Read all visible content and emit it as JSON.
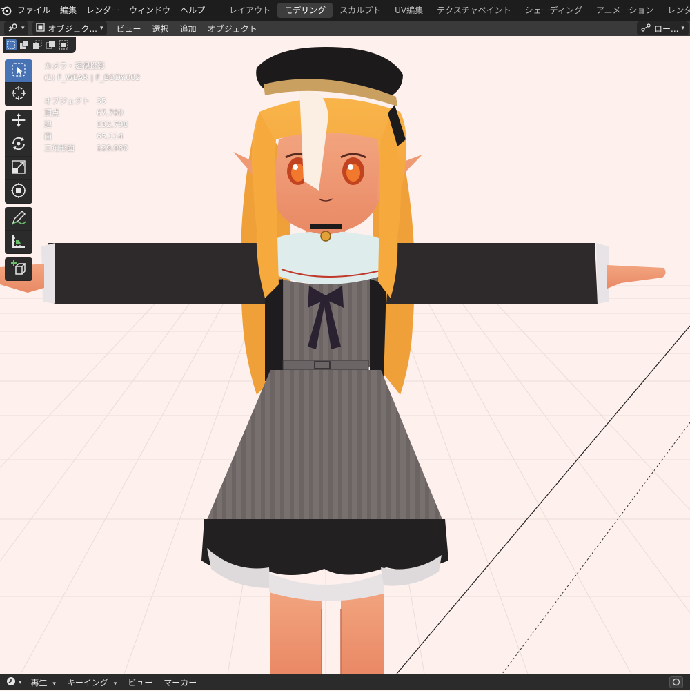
{
  "menu": {
    "items": [
      "ファイル",
      "編集",
      "レンダー",
      "ウィンドウ",
      "ヘルプ"
    ]
  },
  "workspace_tabs": [
    {
      "label": "レイアウト",
      "active": false
    },
    {
      "label": "モデリング",
      "active": true
    },
    {
      "label": "スカルプト",
      "active": false
    },
    {
      "label": "UV編集",
      "active": false
    },
    {
      "label": "テクスチャペイント",
      "active": false
    },
    {
      "label": "シェーディング",
      "active": false
    },
    {
      "label": "アニメーション",
      "active": false
    },
    {
      "label": "レンダリング",
      "active": false
    }
  ],
  "viewport_header": {
    "mode_label": "オブジェク...",
    "menus": [
      "ビュー",
      "選択",
      "追加",
      "オブジェクト"
    ],
    "right_tool_label": "ロー..."
  },
  "overlay": {
    "view_name": "カメラ・透視投影",
    "object_info": "(1) F_WEAR | F_BODY.002",
    "stats": [
      {
        "label": "オブジェクト",
        "value": "35"
      },
      {
        "label": "頂点",
        "value": "67,760"
      },
      {
        "label": "辺",
        "value": "132,798"
      },
      {
        "label": "面",
        "value": "65,114"
      },
      {
        "label": "三角形面",
        "value": "129,980"
      }
    ]
  },
  "toolbar": {
    "tools": [
      "select-box",
      "cursor",
      "move",
      "rotate",
      "scale",
      "transform",
      "annotate",
      "measure",
      "add-cube"
    ],
    "active_tool": "select-box"
  },
  "timeline": {
    "play_label": "再生",
    "keying_label": "キーイング",
    "view_label": "ビュー",
    "marker_label": "マーカー"
  },
  "colors": {
    "accent": "#4772b3",
    "viewport_bg": "#fdf0ed",
    "topbar_bg": "#1d1d1d"
  }
}
